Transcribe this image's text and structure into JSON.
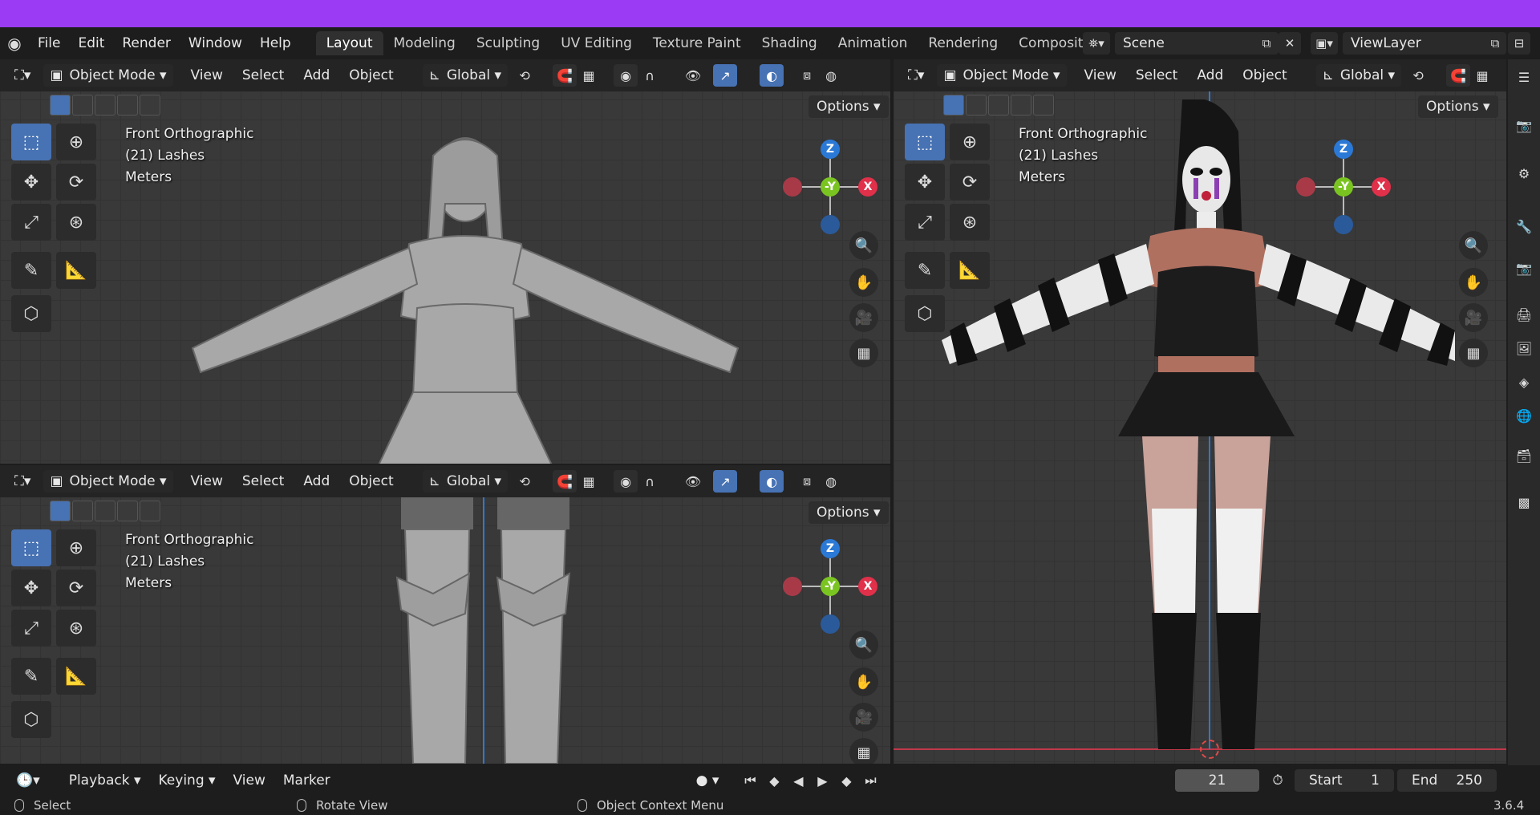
{
  "menu": [
    "File",
    "Edit",
    "Render",
    "Window",
    "Help"
  ],
  "workspace_tabs": [
    "Layout",
    "Modeling",
    "Sculpting",
    "UV Editing",
    "Texture Paint",
    "Shading",
    "Animation",
    "Rendering",
    "Compositin"
  ],
  "active_tab": "Layout",
  "scene": "Scene",
  "view_layer": "ViewLayer",
  "viewport_header": {
    "mode": "Object Mode",
    "view": "View",
    "select": "Select",
    "add": "Add",
    "object": "Object",
    "orientation": "Global",
    "options": "Options"
  },
  "viewport_overlay": {
    "view_name": "Front Orthographic",
    "collection": "(21) Lashes",
    "units": "Meters"
  },
  "gizmo": {
    "z": "Z",
    "y": "-Y",
    "x": "X"
  },
  "timeline": {
    "playback": "Playback",
    "keying": "Keying",
    "view": "View",
    "marker": "Marker",
    "current_frame": "21",
    "start_label": "Start",
    "start_value": "1",
    "end_label": "End",
    "end_value": "250"
  },
  "status_bar": {
    "select": "Select",
    "rotate_view": "Rotate View",
    "object_context_menu": "Object Context Menu",
    "version": "3.6.4"
  },
  "colors": {
    "accent_blue": "#4772b3",
    "top_banner": "#9b3cf4",
    "axis_x": "#e0304a",
    "axis_y": "#7ac421",
    "axis_z": "#2b79d6"
  }
}
